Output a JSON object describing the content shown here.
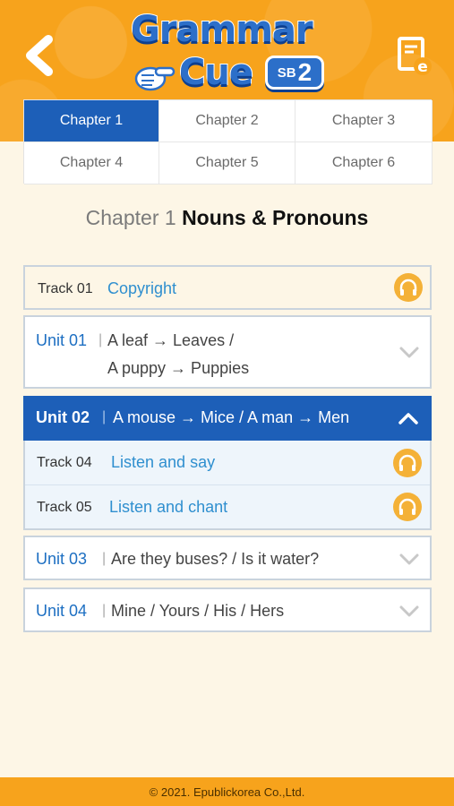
{
  "header": {
    "logo": {
      "word1": "Grammar",
      "word2": "Cue",
      "badge_prefix": "SB",
      "badge_number": "2"
    },
    "back_icon": "chevron-left-icon",
    "ebook_icon": "ebook-icon"
  },
  "chapters": [
    {
      "label": "Chapter 1",
      "active": true
    },
    {
      "label": "Chapter 2",
      "active": false
    },
    {
      "label": "Chapter 3",
      "active": false
    },
    {
      "label": "Chapter 4",
      "active": false
    },
    {
      "label": "Chapter 5",
      "active": false
    },
    {
      "label": "Chapter 6",
      "active": false
    }
  ],
  "chapter_title": {
    "prefix": "Chapter 1",
    "name": "Nouns & Pronouns"
  },
  "list": {
    "track01": {
      "label": "Track 01",
      "title": "Copyright"
    },
    "unit01": {
      "label": "Unit 01",
      "line1": "A leaf → Leaves /",
      "line2": "A puppy → Puppies"
    },
    "unit02": {
      "label": "Unit 02",
      "text": "A mouse → Mice / A man → Men"
    },
    "track04": {
      "label": "Track 04",
      "title": "Listen and say"
    },
    "track05": {
      "label": "Track 05",
      "title": "Listen and chant"
    },
    "unit03": {
      "label": "Unit 03",
      "text": "Are they buses? / Is it water?"
    },
    "unit04": {
      "label": "Unit 04",
      "text": "Mine / Yours / His / Hers"
    },
    "separator": "|"
  },
  "footer": {
    "copyright": "© 2021. Epublickorea Co.,Ltd."
  },
  "colors": {
    "header_orange": "#f7a31c",
    "active_blue": "#1d5fb8",
    "background": "#fdf6e6",
    "headphone_orange": "#f4b137"
  }
}
